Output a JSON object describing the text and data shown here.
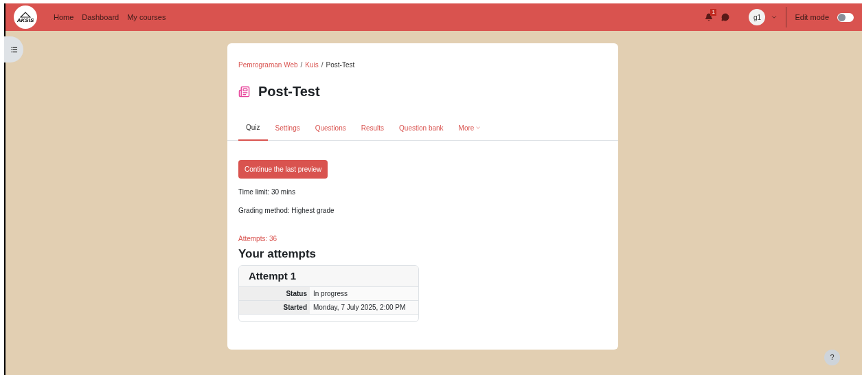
{
  "header": {
    "logo_text": "AKSIS",
    "nav": [
      {
        "label": "Home"
      },
      {
        "label": "Dashboard"
      },
      {
        "label": "My courses"
      }
    ],
    "notification_count": "1",
    "avatar": "g1",
    "edit_mode": {
      "label": "Edit mode",
      "on": false
    }
  },
  "breadcrumb": [
    {
      "label": "Pemrograman Web",
      "link": true
    },
    {
      "label": "Kuis",
      "link": true
    },
    {
      "label": "Post-Test",
      "link": false
    }
  ],
  "breadcrumb_separator": "/",
  "title": "Post-Test",
  "tabs": [
    {
      "label": "Quiz",
      "selected": true,
      "menu": false
    },
    {
      "label": "Settings",
      "selected": false,
      "menu": false
    },
    {
      "label": "Questions",
      "selected": false,
      "menu": false
    },
    {
      "label": "Results",
      "selected": false,
      "menu": false
    },
    {
      "label": "Question bank",
      "selected": false,
      "menu": false
    },
    {
      "label": "More",
      "selected": false,
      "menu": true
    }
  ],
  "continue_button": "Continue the last preview",
  "info": [
    "Time limit: 30 mins",
    "Grading method: Highest grade"
  ],
  "attempts_link": "Attempts: 36",
  "attempts_heading": "Your attempts",
  "attempt": {
    "title": "Attempt 1",
    "rows": [
      {
        "label": "Status",
        "value": "In progress"
      },
      {
        "label": "Started",
        "value": "Monday, 7 July 2025, 2:00 PM"
      }
    ]
  },
  "help": "?"
}
